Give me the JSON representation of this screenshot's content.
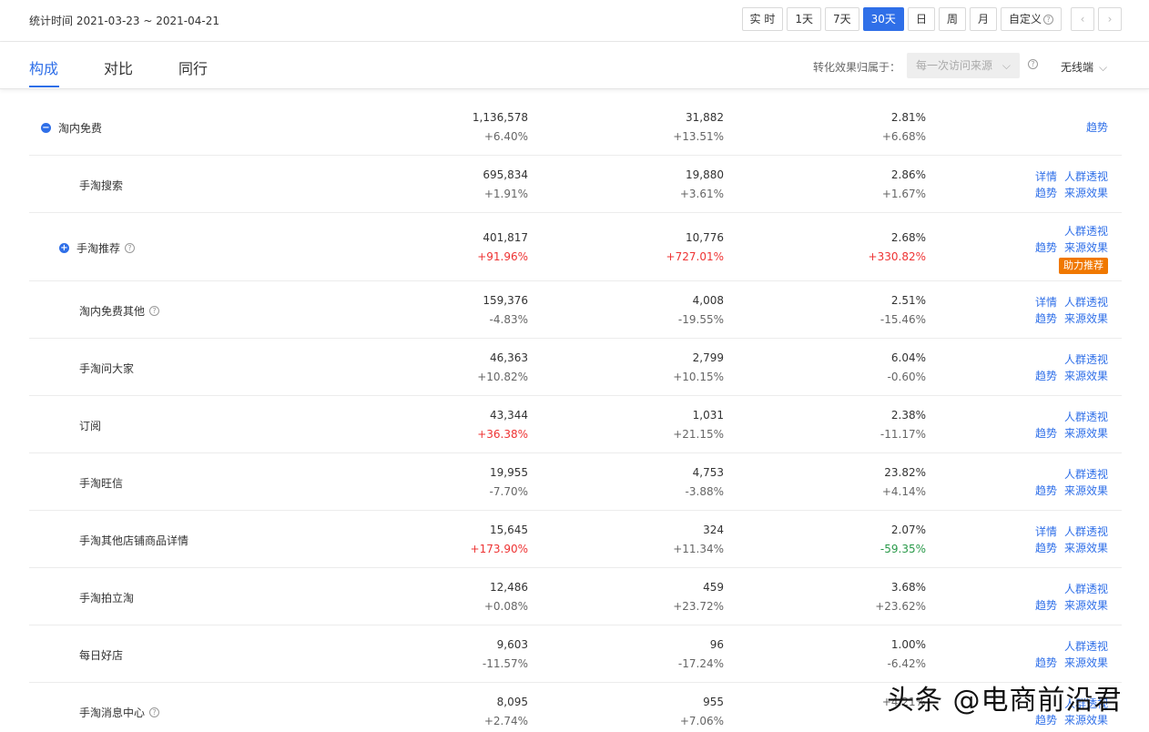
{
  "header": {
    "stat_time": "统计时间 2021-03-23 ~ 2021-04-21",
    "range_buttons": [
      "实 时",
      "1天",
      "7天",
      "30天",
      "日",
      "周",
      "月"
    ],
    "custom_label": "自定义",
    "active_range": "30天"
  },
  "tabs": [
    {
      "label": "构成"
    },
    {
      "label": "对比"
    },
    {
      "label": "同行"
    }
  ],
  "attribution": {
    "label": "转化效果归属于：",
    "value": "每一次访问来源",
    "device": "无线端"
  },
  "rows": [
    {
      "name": "淘内免费",
      "toggle": "−",
      "help": false,
      "c1": "1,136,578",
      "c1d": "+6.40%",
      "c2": "31,882",
      "c2d": "+13.51%",
      "c3": "2.81%",
      "c3d": "+6.68%",
      "actions": [
        "趋势"
      ],
      "actions2": [],
      "badge": ""
    },
    {
      "name": "手淘搜索",
      "toggle": "",
      "help": false,
      "c1": "695,834",
      "c1d": "+1.91%",
      "c2": "19,880",
      "c2d": "+3.61%",
      "c3": "2.86%",
      "c3d": "+1.67%",
      "actions": [
        "详情",
        "人群透视"
      ],
      "actions2": [
        "趋势",
        "来源效果"
      ],
      "badge": ""
    },
    {
      "name": "手淘推荐",
      "toggle": "+",
      "help": true,
      "c1": "401,817",
      "c1d": "+91.96%",
      "c2": "10,776",
      "c2d": "+727.01%",
      "c3": "2.68%",
      "c3d": "+330.82%",
      "actions": [
        "人群透视"
      ],
      "actions2": [
        "趋势",
        "来源效果"
      ],
      "badge": "助力推荐"
    },
    {
      "name": "淘内免费其他",
      "toggle": "",
      "help": true,
      "c1": "159,376",
      "c1d": "-4.83%",
      "c2": "4,008",
      "c2d": "-19.55%",
      "c3": "2.51%",
      "c3d": "-15.46%",
      "actions": [
        "详情",
        "人群透视"
      ],
      "actions2": [
        "趋势",
        "来源效果"
      ],
      "badge": ""
    },
    {
      "name": "手淘问大家",
      "toggle": "",
      "help": false,
      "c1": "46,363",
      "c1d": "+10.82%",
      "c2": "2,799",
      "c2d": "+10.15%",
      "c3": "6.04%",
      "c3d": "-0.60%",
      "actions": [
        "人群透视"
      ],
      "actions2": [
        "趋势",
        "来源效果"
      ],
      "badge": ""
    },
    {
      "name": "订阅",
      "toggle": "",
      "help": false,
      "c1": "43,344",
      "c1d": "+36.38%",
      "c2": "1,031",
      "c2d": "+21.15%",
      "c3": "2.38%",
      "c3d": "-11.17%",
      "actions": [
        "人群透视"
      ],
      "actions2": [
        "趋势",
        "来源效果"
      ],
      "badge": ""
    },
    {
      "name": "手淘旺信",
      "toggle": "",
      "help": false,
      "c1": "19,955",
      "c1d": "-7.70%",
      "c2": "4,753",
      "c2d": "-3.88%",
      "c3": "23.82%",
      "c3d": "+4.14%",
      "actions": [
        "人群透视"
      ],
      "actions2": [
        "趋势",
        "来源效果"
      ],
      "badge": ""
    },
    {
      "name": "手淘其他店铺商品详情",
      "toggle": "",
      "help": false,
      "c1": "15,645",
      "c1d": "+173.90%",
      "c2": "324",
      "c2d": "+11.34%",
      "c3": "2.07%",
      "c3d": "-59.35%",
      "actions": [
        "详情",
        "人群透视"
      ],
      "actions2": [
        "趋势",
        "来源效果"
      ],
      "badge": ""
    },
    {
      "name": "手淘拍立淘",
      "toggle": "",
      "help": false,
      "c1": "12,486",
      "c1d": "+0.08%",
      "c2": "459",
      "c2d": "+23.72%",
      "c3": "3.68%",
      "c3d": "+23.62%",
      "actions": [
        "人群透视"
      ],
      "actions2": [
        "趋势",
        "来源效果"
      ],
      "badge": ""
    },
    {
      "name": "每日好店",
      "toggle": "",
      "help": false,
      "c1": "9,603",
      "c1d": "-11.57%",
      "c2": "96",
      "c2d": "-17.24%",
      "c3": "1.00%",
      "c3d": "-6.42%",
      "actions": [
        "人群透视"
      ],
      "actions2": [
        "趋势",
        "来源效果"
      ],
      "badge": ""
    },
    {
      "name": "手淘消息中心",
      "toggle": "",
      "help": true,
      "c1": "8,095",
      "c1d": "+2.74%",
      "c2": "955",
      "c2d": "+7.06%",
      "c3": "",
      "c3d": "+4.21%",
      "actions": [
        "人群透视"
      ],
      "actions2": [
        "趋势",
        "来源效果"
      ],
      "badge": ""
    }
  ],
  "change_colors": {
    "up_red": [
      "+91.96%",
      "+727.01%",
      "+330.82%",
      "+36.38%",
      "+173.90%"
    ],
    "down_green": [
      "-59.35%"
    ]
  },
  "watermark": "头条 @电商前沿君",
  "colors": {
    "accent": "#2f6fe8",
    "badge": "#f07800",
    "up": "#e33333",
    "down": "#2a9a4a"
  }
}
